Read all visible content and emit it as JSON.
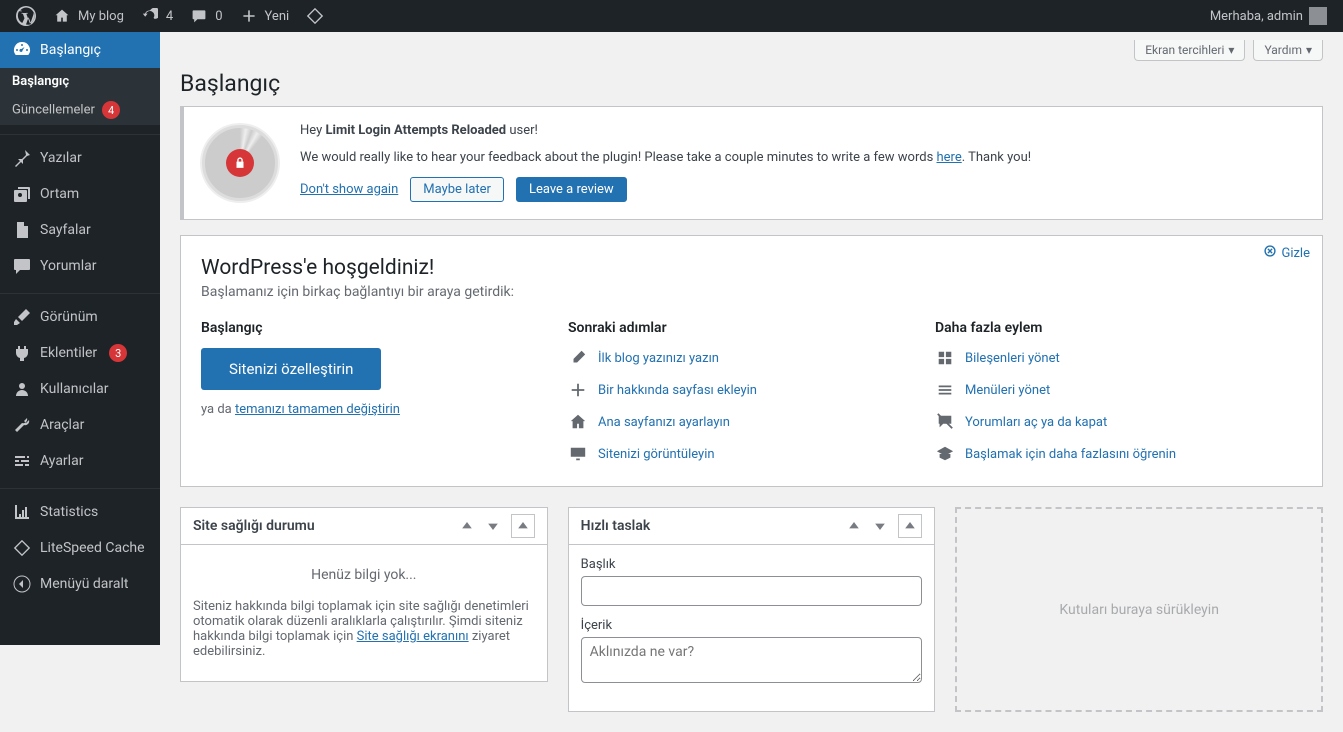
{
  "adminbar": {
    "site_name": "My blog",
    "updates_count": "4",
    "comments_count": "0",
    "new_label": "Yeni",
    "greeting": "Merhaba, admin"
  },
  "sidebar": {
    "dashboard": "Başlangıç",
    "sub_home": "Başlangıç",
    "sub_updates": "Güncellemeler",
    "updates_badge": "4",
    "posts": "Yazılar",
    "media": "Ortam",
    "pages": "Sayfalar",
    "comments": "Yorumlar",
    "appearance": "Görünüm",
    "plugins": "Eklentiler",
    "plugins_badge": "3",
    "users": "Kullanıcılar",
    "tools": "Araçlar",
    "settings": "Ayarlar",
    "statistics": "Statistics",
    "litespeed": "LiteSpeed Cache",
    "collapse": "Menüyü daralt"
  },
  "top_actions": {
    "screen_options": "Ekran tercihleri",
    "help": "Yardım"
  },
  "page_title": "Başlangıç",
  "notice": {
    "line1_prefix": "Hey ",
    "line1_bold": "Limit Login Attempts Reloaded",
    "line1_suffix": " user!",
    "line2_prefix": "We would really like to hear your feedback about the plugin! Please take a couple minutes to write a few words ",
    "line2_link": "here",
    "line2_suffix": ". Thank you!",
    "dont_show": "Don't show again",
    "maybe_later": "Maybe later",
    "leave_review": "Leave a review"
  },
  "welcome": {
    "title": "WordPress'e hoşgeldiniz!",
    "subtitle": "Başlamanız için birkaç bağlantıyı bir araya getirdik:",
    "dismiss": "Gizle",
    "col1_heading": "Başlangıç",
    "customize_button": "Sitenizi özelleştirin",
    "or_prefix": "ya da ",
    "or_link": "temanızı tamamen değiştirin",
    "col2_heading": "Sonraki adımlar",
    "col2_items": [
      "İlk blog yazınızı yazın",
      "Bir hakkında sayfası ekleyin",
      "Ana sayfanızı ayarlayın",
      "Sitenizi görüntüleyin"
    ],
    "col3_heading": "Daha fazla eylem",
    "col3_items": [
      "Bileşenleri yönet",
      "Menüleri yönet",
      "Yorumları aç ya da kapat",
      "Başlamak için daha fazlasını öğrenin"
    ]
  },
  "dashboard": {
    "site_health": {
      "title": "Site sağlığı durumu",
      "status": "Henüz bilgi yok...",
      "text_prefix": "Siteniz hakkında bilgi toplamak için site sağlığı denetimleri otomatik olarak düzenli aralıklarla çalıştırılır. Şimdi siteniz hakkında bilgi toplamak için ",
      "text_link": "Site sağlığı ekranını",
      "text_suffix": " ziyaret edebilirsiniz."
    },
    "quick_draft": {
      "title": "Hızlı taslak",
      "label_title": "Başlık",
      "label_content": "İçerik",
      "placeholder_content": "Aklınızda ne var?"
    },
    "dropzone": "Kutuları buraya sürükleyin"
  }
}
